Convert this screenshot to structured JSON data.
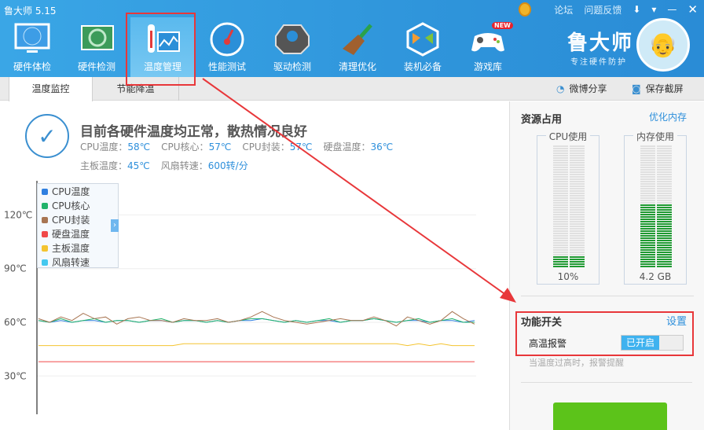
{
  "window": {
    "title": "鲁大师 5.15",
    "links": [
      "论坛",
      "问题反馈"
    ]
  },
  "nav": [
    {
      "label": "硬件体检",
      "icon": "monitor-radar-icon"
    },
    {
      "label": "硬件检测",
      "icon": "graphics-card-icon"
    },
    {
      "label": "温度管理",
      "icon": "thermometer-chart-icon"
    },
    {
      "label": "性能测试",
      "icon": "speedometer-icon"
    },
    {
      "label": "驱动检测",
      "icon": "gear-box-icon"
    },
    {
      "label": "清理优化",
      "icon": "broom-icon"
    },
    {
      "label": "装机必备",
      "icon": "cube-icon"
    },
    {
      "label": "游戏库",
      "icon": "gamepad-icon",
      "badge": "NEW"
    }
  ],
  "brand": {
    "name": "鲁大师",
    "slogan": "专注硬件防护"
  },
  "tabs": [
    "温度监控",
    "节能降温"
  ],
  "toolbar": {
    "share": "微博分享",
    "screenshot": "保存截屏"
  },
  "status": {
    "headline": "目前各硬件温度均正常，散热情况良好",
    "stats": [
      {
        "label": "CPU温度：",
        "value": "58℃"
      },
      {
        "label": "CPU核心：",
        "value": "57℃"
      },
      {
        "label": "CPU封装：",
        "value": "57℃"
      },
      {
        "label": "硬盘温度：",
        "value": "36℃"
      },
      {
        "label": "主板温度：",
        "value": "45℃"
      },
      {
        "label": "风扇转速：",
        "value": "600转/分"
      }
    ]
  },
  "chart_data": {
    "type": "line",
    "ylabel": "℃",
    "ylim": [
      0,
      130
    ],
    "yticks": [
      "120℃",
      "90℃",
      "60℃",
      "30℃"
    ],
    "ytick_values": [
      120,
      90,
      60,
      30
    ],
    "legend": [
      "CPU温度",
      "CPU核心",
      "CPU封装",
      "硬盘温度",
      "主板温度",
      "风扇转速"
    ],
    "colors": [
      "#2f7fe0",
      "#21b36b",
      "#a87552",
      "#f04848",
      "#f4c430",
      "#44c8ef"
    ],
    "series": [
      {
        "name": "CPU温度",
        "values": [
          61,
          60,
          61,
          60,
          61,
          61,
          60,
          61,
          61,
          60,
          61,
          61,
          60,
          61,
          61,
          60,
          61,
          60,
          61,
          61,
          62,
          61,
          60,
          61,
          60,
          61,
          61,
          60,
          61,
          61,
          62,
          61,
          60,
          61,
          61,
          60,
          61,
          61,
          60,
          61
        ]
      },
      {
        "name": "CPU核心",
        "values": [
          61,
          60,
          62,
          60,
          61,
          62,
          60,
          61,
          61,
          60,
          61,
          62,
          60,
          61,
          61,
          60,
          61,
          60,
          61,
          62,
          62,
          61,
          60,
          61,
          60,
          61,
          62,
          60,
          61,
          61,
          62,
          61,
          60,
          61,
          62,
          60,
          61,
          62,
          60,
          60
        ]
      },
      {
        "name": "CPU封装",
        "values": [
          62,
          60,
          63,
          61,
          65,
          62,
          63,
          59,
          62,
          63,
          61,
          61,
          60,
          62,
          61,
          61,
          62,
          60,
          61,
          63,
          66,
          63,
          61,
          60,
          59,
          60,
          61,
          62,
          61,
          61,
          63,
          61,
          58,
          63,
          61,
          59,
          61,
          66,
          62,
          59
        ]
      },
      {
        "name": "硬盘温度",
        "values": [
          38,
          38,
          38,
          38,
          38,
          38,
          38,
          38,
          38,
          38,
          38,
          38,
          38,
          38,
          38,
          38,
          38,
          38,
          38,
          38,
          38,
          38,
          38,
          38,
          38,
          38,
          38,
          38,
          38,
          38,
          38,
          38,
          38,
          38,
          38,
          38,
          38,
          38,
          38,
          38
        ]
      },
      {
        "name": "主板温度",
        "values": [
          47,
          47,
          47,
          47,
          47,
          47,
          47,
          47,
          47,
          47,
          47,
          47,
          47,
          48,
          48,
          48,
          48,
          48,
          48,
          48,
          48,
          48,
          48,
          48,
          48,
          48,
          48,
          48,
          48,
          48,
          48,
          48,
          48,
          47,
          48,
          47,
          48,
          47,
          47,
          47
        ]
      }
    ]
  },
  "resources": {
    "title": "资源占用",
    "optimize": "优化内存",
    "cpu": {
      "label": "CPU使用",
      "value": "10%",
      "fraction": 0.1
    },
    "mem": {
      "label": "内存使用",
      "value": "4.2 GB",
      "fraction": 0.52
    }
  },
  "features": {
    "title": "功能开关",
    "settings": "设置",
    "alarm": {
      "label": "高温报警",
      "state": "已开启",
      "hint": "当温度过高时，报警提醒"
    }
  }
}
